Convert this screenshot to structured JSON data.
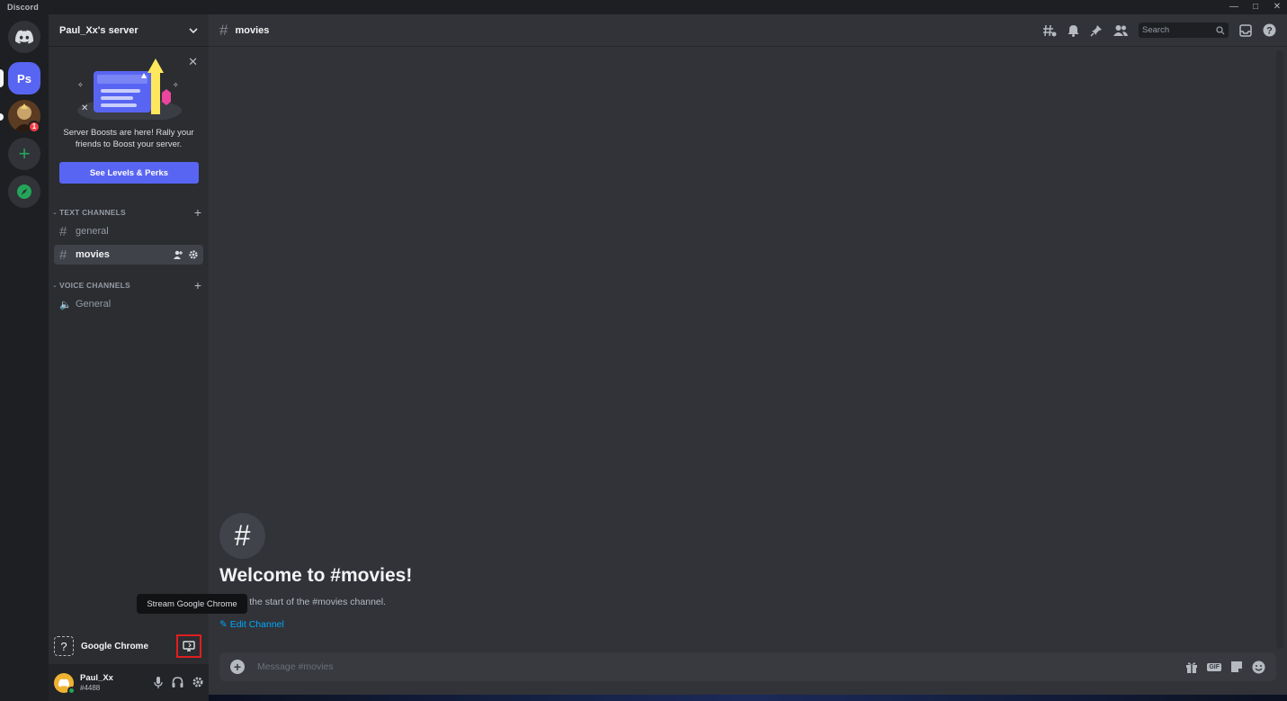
{
  "window": {
    "app_name": "Discord",
    "controls": [
      "minimize-icon",
      "maximize-icon",
      "close-icon"
    ]
  },
  "servers": {
    "home_icon": "discord-logo-icon",
    "active_server_initials": "Ps",
    "mention_badge": "1",
    "add_icon": "plus-icon",
    "explore_icon": "compass-icon"
  },
  "sidebar": {
    "server_name": "Paul_Xx's server",
    "boost": {
      "text": "Server Boosts are here! Rally your friends to Boost your server.",
      "button": "See Levels & Perks"
    },
    "categories": [
      {
        "label": "TEXT CHANNELS",
        "channels": [
          {
            "name": "general",
            "active": false
          },
          {
            "name": "movies",
            "active": true
          }
        ]
      },
      {
        "label": "VOICE CHANNELS",
        "channels": [
          {
            "name": "General",
            "type": "voice"
          }
        ]
      }
    ],
    "activity": {
      "game": "Google Chrome",
      "tooltip": "Stream Google Chrome"
    },
    "user": {
      "name": "Paul_Xx",
      "tag": "#4488",
      "status": "online"
    }
  },
  "main": {
    "channel": "movies",
    "search_placeholder": "Search",
    "welcome_title": "Welcome to #movies!",
    "welcome_sub": "This is the start of the #movies channel.",
    "edit_link": "Edit Channel",
    "composer_placeholder": "Message #movies",
    "gif_label": "GIF"
  },
  "colors": {
    "accent": "#5865f2",
    "online": "#23a55a",
    "highlight_box": "#e01e1e"
  }
}
